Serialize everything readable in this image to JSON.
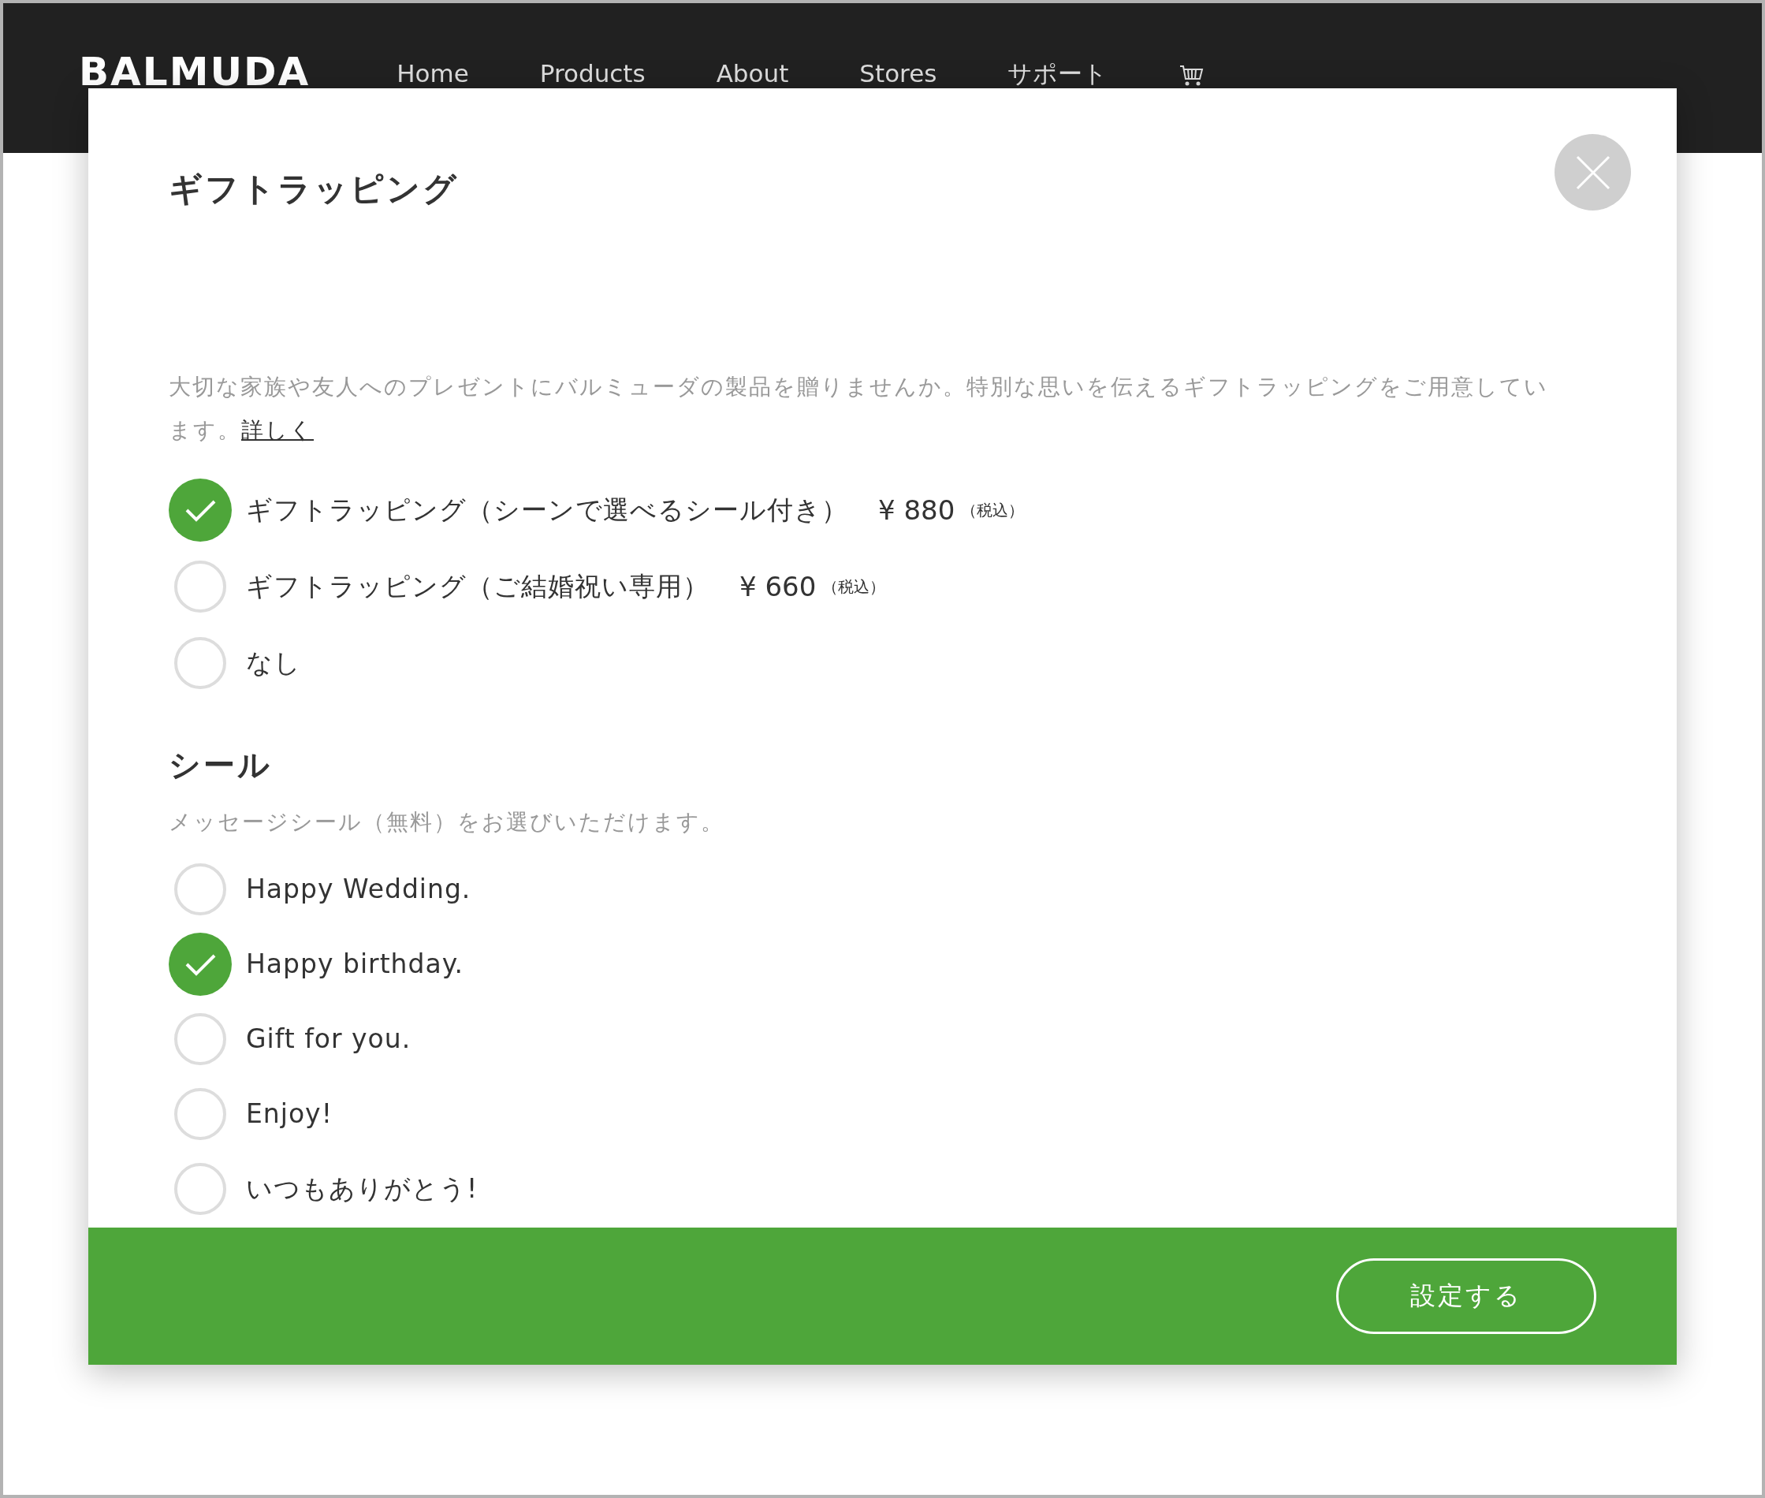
{
  "header": {
    "logo": "BALMUDA",
    "nav": [
      {
        "label": "Home"
      },
      {
        "label": "Products"
      },
      {
        "label": "About"
      },
      {
        "label": "Stores"
      },
      {
        "label": "サポート"
      }
    ]
  },
  "dialog": {
    "title": "ギフトラッピング",
    "description": "大切な家族や友人へのプレゼントにバルミューダの製品を贈りませんか。特別な思いを伝えるギフトラッピングをご用意しています。",
    "details_link": "詳しく",
    "wrapping_options": [
      {
        "label": "ギフトラッピング（シーンで選べるシール付き）",
        "price": "¥ 880",
        "tax_note": "（税込）",
        "selected": true
      },
      {
        "label": "ギフトラッピング（ご結婚祝い専用）",
        "price": "¥ 660",
        "tax_note": "（税込）",
        "selected": false
      },
      {
        "label": "なし",
        "selected": false
      }
    ],
    "seal": {
      "heading": "シール",
      "description": "メッセージシール（無料）をお選びいただけます。",
      "options": [
        {
          "label": "Happy Wedding.",
          "selected": false
        },
        {
          "label": "Happy birthday.",
          "selected": true
        },
        {
          "label": "Gift for you.",
          "selected": false
        },
        {
          "label": "Enjoy!",
          "selected": false
        },
        {
          "label": "いつもありがとう!",
          "selected": false
        }
      ]
    },
    "confirm_button": "設定する"
  }
}
